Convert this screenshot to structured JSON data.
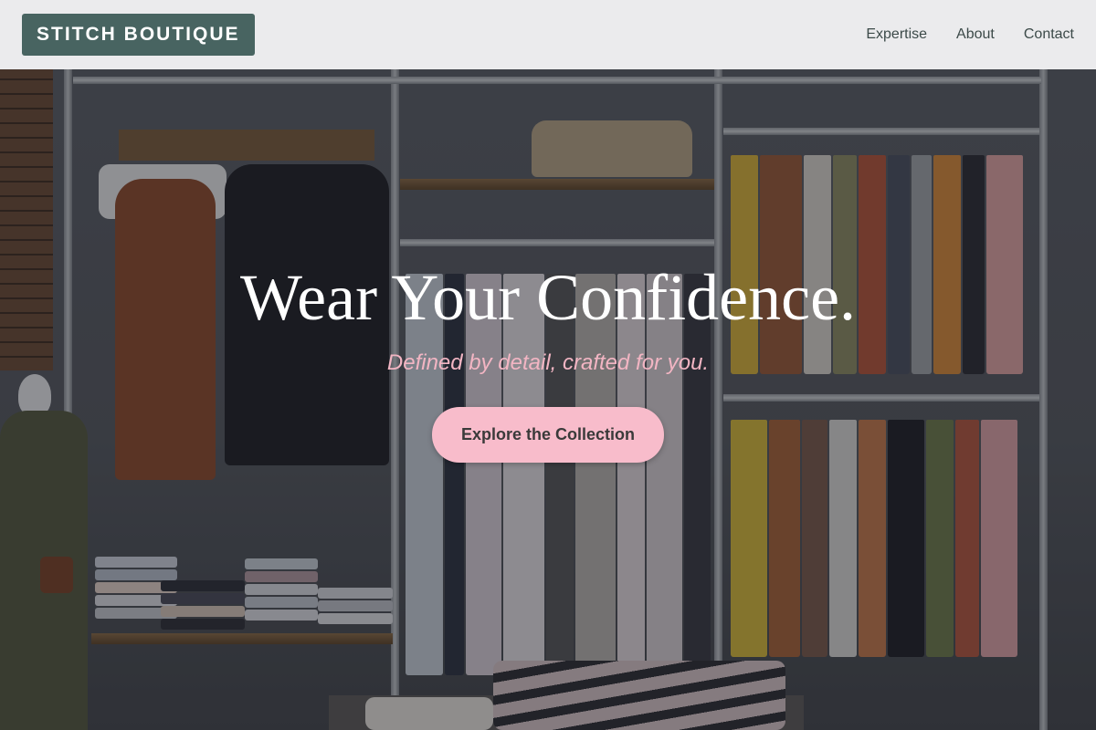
{
  "navbar": {
    "brand": "STITCH BOUTIQUE",
    "links": [
      {
        "label": "Expertise"
      },
      {
        "label": "About"
      },
      {
        "label": "Contact"
      }
    ]
  },
  "hero": {
    "headline": "Wear Your Confidence.",
    "subheadline": "Defined by detail, crafted for you.",
    "cta_label": "Explore the Collection",
    "background_image": "clothing-store-interior-photo"
  },
  "colors": {
    "brand_bg": "#486461",
    "cta_bg": "#f8bccb",
    "subheadline": "#f2b5c3",
    "nav_bg": "#f3f3f4"
  }
}
